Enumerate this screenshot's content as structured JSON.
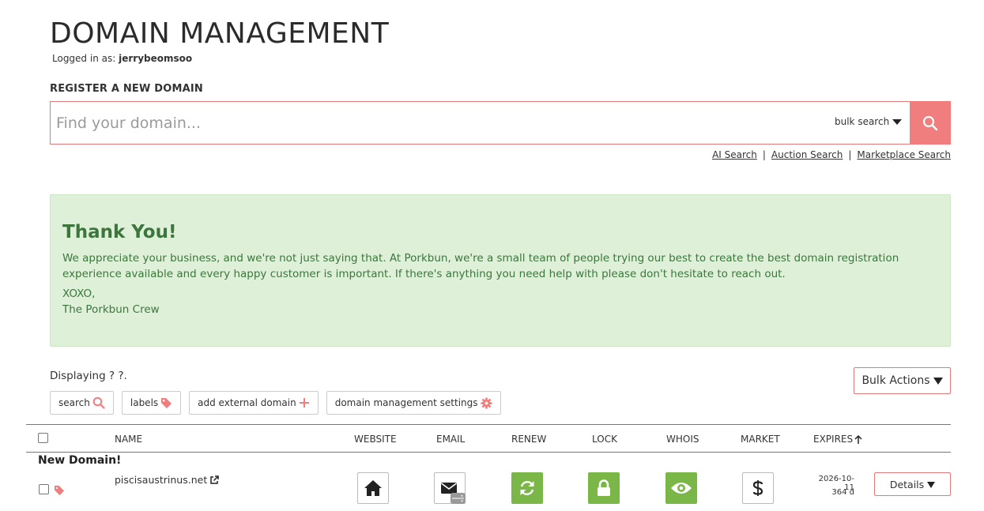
{
  "header": {
    "title": "DOMAIN MANAGEMENT",
    "logged_in_prefix": "Logged in as:",
    "username": "jerrybeomsoo"
  },
  "register": {
    "heading": "REGISTER A NEW DOMAIN",
    "search_placeholder": "Find your domain...",
    "bulk_search_label": "bulk search",
    "links": [
      "AI Search",
      "Auction Search",
      "Marketplace Search"
    ]
  },
  "thank_you": {
    "title": "Thank You!",
    "message": "We appreciate your business, and we're not just saying that. At Porkbun, we're a small team of people trying our best to create the best domain registration experience available and every happy customer is important. If there's anything you need help with please don't hesitate to reach out.",
    "signoff_1": "XOXO,",
    "signoff_2": "The Porkbun Crew"
  },
  "listing": {
    "displaying_text": "Displaying ? ?.",
    "bulk_actions_label": "Bulk Actions",
    "tools": {
      "search": "search",
      "labels": "labels",
      "add_external": "add external domain",
      "settings": "domain management settings"
    }
  },
  "table": {
    "columns": {
      "name": "NAME",
      "website": "WEBSITE",
      "email": "EMAIL",
      "renew": "RENEW",
      "lock": "LOCK",
      "whois": "WHOIS",
      "market": "MARKET",
      "expires": "EXPIRES"
    },
    "group_label": "New Domain!",
    "rows": [
      {
        "domain": "piscisaustrinus.net",
        "expires_date": "2026-10-11",
        "expires_days": "364 d",
        "details_label": "Details",
        "renew_status": "on",
        "lock_status": "on",
        "whois_status": "on"
      }
    ]
  },
  "colors": {
    "accent": "#f07e7e",
    "success_bg": "#dff0d8",
    "success_text": "#3c763d",
    "enabled_green": "#7ab648"
  },
  "icons": [
    "search-icon",
    "tag-icon",
    "plus-icon",
    "gear-icon",
    "external-link-icon",
    "home-icon",
    "envelope-icon",
    "refresh-icon",
    "lock-icon",
    "eye-icon",
    "dollar-icon",
    "caret-down-icon",
    "arrow-up-icon"
  ]
}
